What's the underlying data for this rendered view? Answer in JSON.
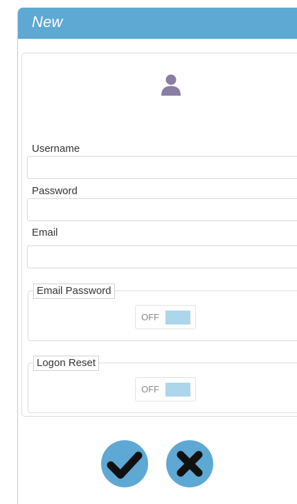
{
  "dialog": {
    "title": "New"
  },
  "form": {
    "username": {
      "label": "Username",
      "value": "",
      "placeholder": ""
    },
    "password": {
      "label": "Password",
      "value": "",
      "placeholder": ""
    },
    "email": {
      "label": "Email",
      "value": "",
      "placeholder": ""
    },
    "email_password": {
      "legend": "Email Password",
      "toggle_state": "OFF"
    },
    "logon_reset": {
      "legend": "Logon Reset",
      "toggle_state": "OFF"
    }
  },
  "actions": {
    "confirm_icon": "checkmark-icon",
    "cancel_icon": "x-icon"
  },
  "colors": {
    "accent": "#5ea8d4",
    "toggle_off": "#acd6ec",
    "avatar": "#8a7ea3"
  }
}
